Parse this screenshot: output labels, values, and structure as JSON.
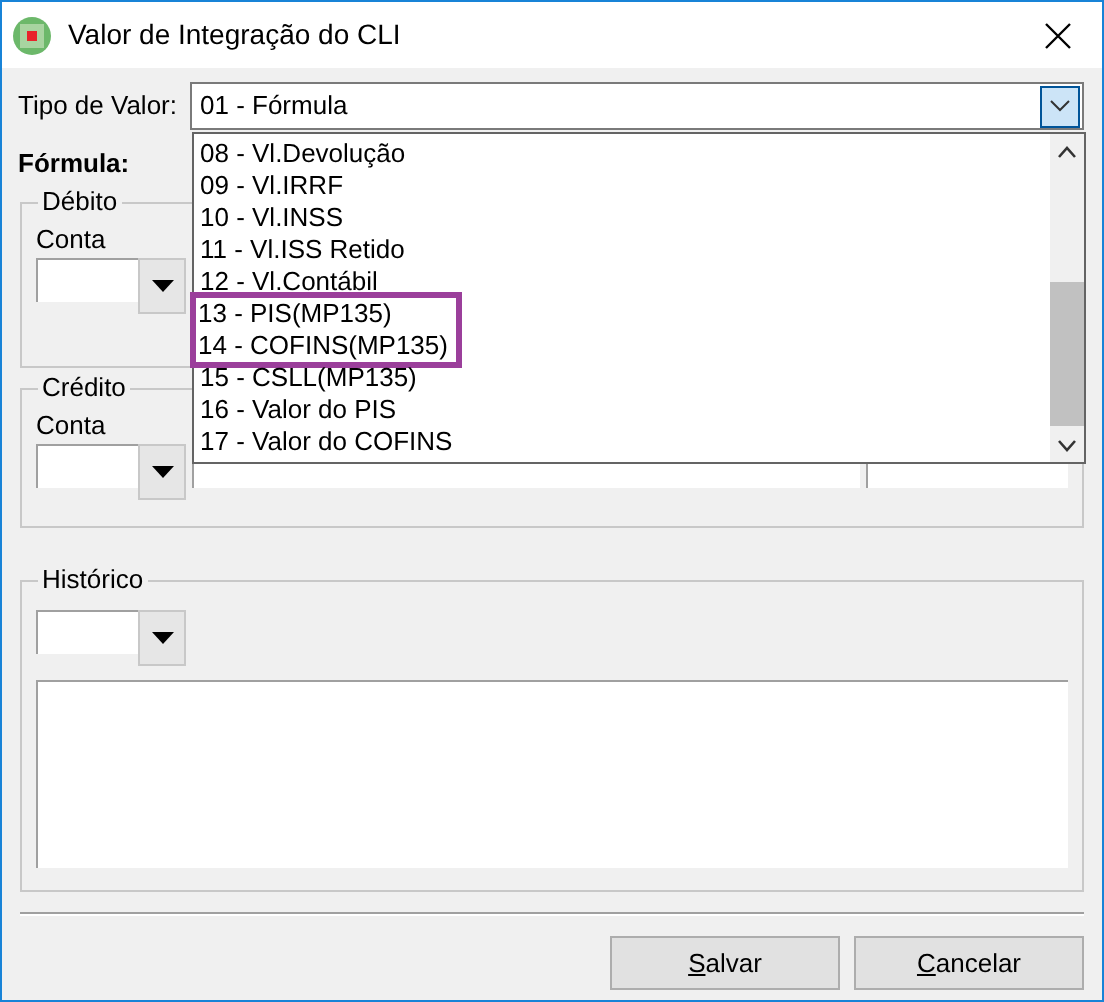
{
  "window": {
    "title": "Valor de Integração do CLI"
  },
  "tipo_de_valor": {
    "label": "Tipo de Valor:",
    "value": "01 - Fórmula",
    "expanded": true,
    "options": [
      {
        "label": "08 - Vl.Devolução",
        "highlighted": false
      },
      {
        "label": "09 - Vl.IRRF",
        "highlighted": false
      },
      {
        "label": "10 - Vl.INSS",
        "highlighted": false
      },
      {
        "label": "11 - Vl.ISS Retido",
        "highlighted": false
      },
      {
        "label": "12 - Vl.Contábil",
        "highlighted": false
      },
      {
        "label": "13 - PIS(MP135)",
        "highlighted": true
      },
      {
        "label": "14 - COFINS(MP135)",
        "highlighted": true
      },
      {
        "label": "15 - CSLL(MP135)",
        "highlighted": false
      },
      {
        "label": "16 - Valor do PIS",
        "highlighted": false
      },
      {
        "label": "17 - Valor do COFINS",
        "highlighted": false
      }
    ]
  },
  "formula": {
    "label": "Fórmula:"
  },
  "debito": {
    "title": "Débito",
    "conta_label": "Conta"
  },
  "credito": {
    "title": "Crédito",
    "conta_label": "Conta"
  },
  "historico": {
    "title": "Histórico"
  },
  "buttons": [
    {
      "label": "Salvar"
    },
    {
      "label": "Cancelar"
    }
  ]
}
